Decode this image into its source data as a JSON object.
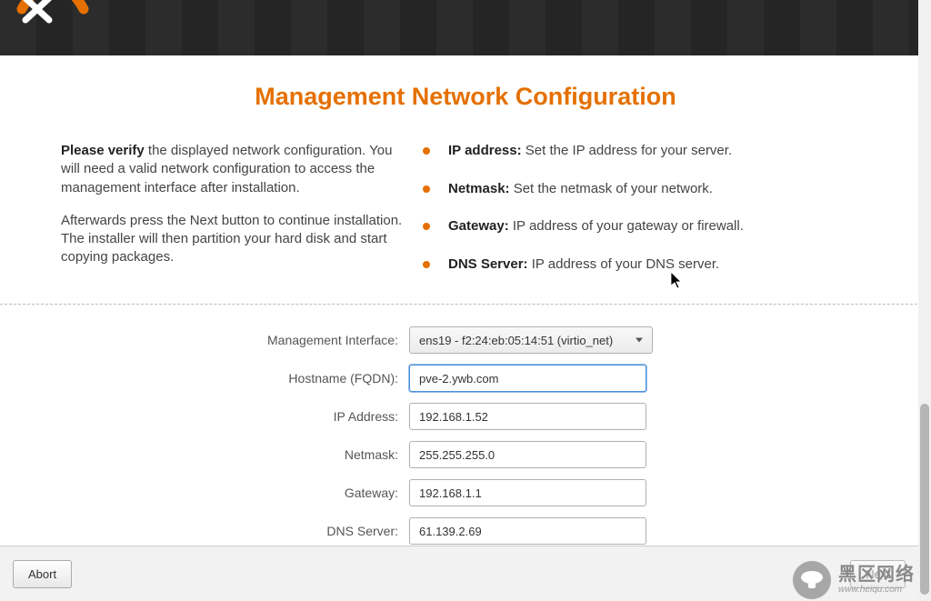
{
  "header": {
    "title": "Management Network Configuration"
  },
  "left_column": {
    "verify_bold": "Please verify",
    "verify_rest": " the displayed network configuration. You will need a valid network configuration to access the management interface after installation.",
    "para2": "Afterwards press the Next button to continue installation. The installer will then partition your hard disk and start copying packages."
  },
  "right_column": {
    "items": [
      {
        "label": "IP address:",
        "desc": " Set the IP address for your server."
      },
      {
        "label": "Netmask:",
        "desc": " Set the netmask of your network."
      },
      {
        "label": "Gateway:",
        "desc": " IP address of your gateway or firewall."
      },
      {
        "label": "DNS Server:",
        "desc": " IP address of your DNS server."
      }
    ]
  },
  "form": {
    "labels": {
      "interface": "Management Interface:",
      "hostname": "Hostname (FQDN):",
      "ip": "IP Address:",
      "netmask": "Netmask:",
      "gateway": "Gateway:",
      "dns": "DNS Server:"
    },
    "values": {
      "interface": "ens19 - f2:24:eb:05:14:51 (virtio_net)",
      "hostname": "pve-2.ywb.com",
      "ip": "192.168.1.52",
      "netmask": "255.255.255.0",
      "gateway": "192.168.1.1",
      "dns": "61.139.2.69"
    }
  },
  "footer": {
    "abort": "Abort",
    "next": "Next"
  },
  "watermark": {
    "cn": "黑区网络",
    "url": "www.heiqu.com"
  }
}
